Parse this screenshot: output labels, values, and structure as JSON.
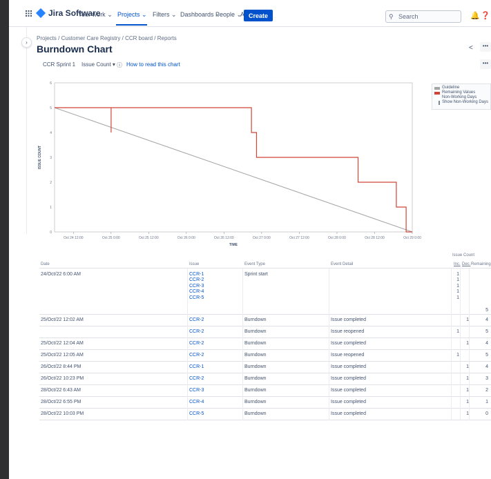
{
  "nav": {
    "logo": "Jira Software",
    "menu": [
      "Your work",
      "Projects",
      "Filters",
      "Dashboards",
      "People",
      "Apps"
    ],
    "create_label": "Create",
    "search_placeholder": "Search"
  },
  "breadcrumbs": [
    "Projects",
    "Customer Care Registry",
    "CCR board",
    "Reports"
  ],
  "page_title": "Burndown Chart",
  "toolbar": {
    "sprint": "CCR Sprint 1",
    "metric": "Issue Count",
    "help_link": "How to read this chart"
  },
  "legend": {
    "guideline": "Guideline",
    "remaining": "Remaining Values",
    "non_working": "Non-Working Days",
    "show_non_working": "Show Non-Working Days"
  },
  "colors": {
    "guideline": "#a5a5a5",
    "remaining": "#d04437",
    "link": "#0052cc",
    "brand": "#0052cc"
  },
  "chart_data": {
    "type": "line",
    "xlabel": "TIME",
    "ylabel": "ISSUE COUNT",
    "ylim": [
      0,
      6
    ],
    "yticks": [
      0,
      1,
      2,
      3,
      4,
      5,
      6
    ],
    "xticks": [
      "Oct 24 12:00",
      "Oct 25 0:00",
      "Oct 25 12:00",
      "Oct 26 0:00",
      "Oct 26 12:00",
      "Oct 27 0:00",
      "Oct 27 12:00",
      "Oct 28 0:00",
      "Oct 28 12:00",
      "Oct 29 0:00"
    ],
    "x_start": "Oct 24 6:00",
    "x_end": "Oct 29 0:00",
    "series": [
      {
        "name": "Guideline",
        "points": [
          [
            "Oct 24 6:00",
            5
          ],
          [
            "Oct 29 0:00",
            0
          ]
        ]
      },
      {
        "name": "Remaining Values",
        "points": [
          [
            "Oct 24 6:00",
            5
          ],
          [
            "Oct 25 0:02",
            5
          ],
          [
            "Oct 25 0:02",
            4
          ],
          [
            "Oct 25 0:02",
            5
          ],
          [
            "Oct 26 20:44",
            5
          ],
          [
            "Oct 26 20:44",
            4
          ],
          [
            "Oct 26 22:23",
            4
          ],
          [
            "Oct 26 22:23",
            3
          ],
          [
            "Oct 28 6:43",
            3
          ],
          [
            "Oct 28 6:43",
            2
          ],
          [
            "Oct 28 18:55",
            2
          ],
          [
            "Oct 28 18:55",
            1
          ],
          [
            "Oct 28 22:03",
            1
          ],
          [
            "Oct 28 22:03",
            0
          ],
          [
            "Oct 29 0:00",
            0
          ]
        ]
      }
    ]
  },
  "table": {
    "group_header": "Issue Count",
    "headers": {
      "date": "Date",
      "issue": "Issue",
      "event_type": "Event Type",
      "event_detail": "Event Detail",
      "inc": "Inc.",
      "dec": "Dec.",
      "remaining": "Remaining"
    },
    "rows": [
      {
        "date": "24/Oct/22 6:00 AM",
        "issues": [
          "CCR-1",
          "CCR-2",
          "CCR-3",
          "CCR-4",
          "CCR-5"
        ],
        "type": "Sprint start",
        "detail": "",
        "inc": [
          "1",
          "1",
          "1",
          "1",
          "1"
        ],
        "dec": "",
        "remaining": "5"
      },
      {
        "date": "25/Oct/22 12:02 AM",
        "issues": [
          "CCR-2"
        ],
        "type": "Burndown",
        "detail": "Issue completed",
        "inc": [],
        "dec": "1",
        "remaining": "4"
      },
      {
        "date": "",
        "issues": [
          "CCR-2"
        ],
        "type": "Burndown",
        "detail": "Issue reopened",
        "inc": [
          "1"
        ],
        "dec": "",
        "remaining": "5"
      },
      {
        "date": "25/Oct/22 12:04 AM",
        "issues": [
          "CCR-2"
        ],
        "type": "Burndown",
        "detail": "Issue completed",
        "inc": [],
        "dec": "1",
        "remaining": "4"
      },
      {
        "date": "25/Oct/22 12:05 AM",
        "issues": [
          "CCR-2"
        ],
        "type": "Burndown",
        "detail": "Issue reopened",
        "inc": [
          "1"
        ],
        "dec": "",
        "remaining": "5"
      },
      {
        "date": "26/Oct/22 8:44 PM",
        "issues": [
          "CCR-1"
        ],
        "type": "Burndown",
        "detail": "Issue completed",
        "inc": [],
        "dec": "1",
        "remaining": "4"
      },
      {
        "date": "26/Oct/22 10:23 PM",
        "issues": [
          "CCR-2"
        ],
        "type": "Burndown",
        "detail": "Issue completed",
        "inc": [],
        "dec": "1",
        "remaining": "3"
      },
      {
        "date": "28/Oct/22 6:43 AM",
        "issues": [
          "CCR-3"
        ],
        "type": "Burndown",
        "detail": "Issue completed",
        "inc": [],
        "dec": "1",
        "remaining": "2"
      },
      {
        "date": "28/Oct/22 6:55 PM",
        "issues": [
          "CCR-4"
        ],
        "type": "Burndown",
        "detail": "Issue completed",
        "inc": [],
        "dec": "1",
        "remaining": "1"
      },
      {
        "date": "28/Oct/22 10:03 PM",
        "issues": [
          "CCR-5"
        ],
        "type": "Burndown",
        "detail": "Issue completed",
        "inc": [],
        "dec": "1",
        "remaining": "0"
      }
    ]
  }
}
